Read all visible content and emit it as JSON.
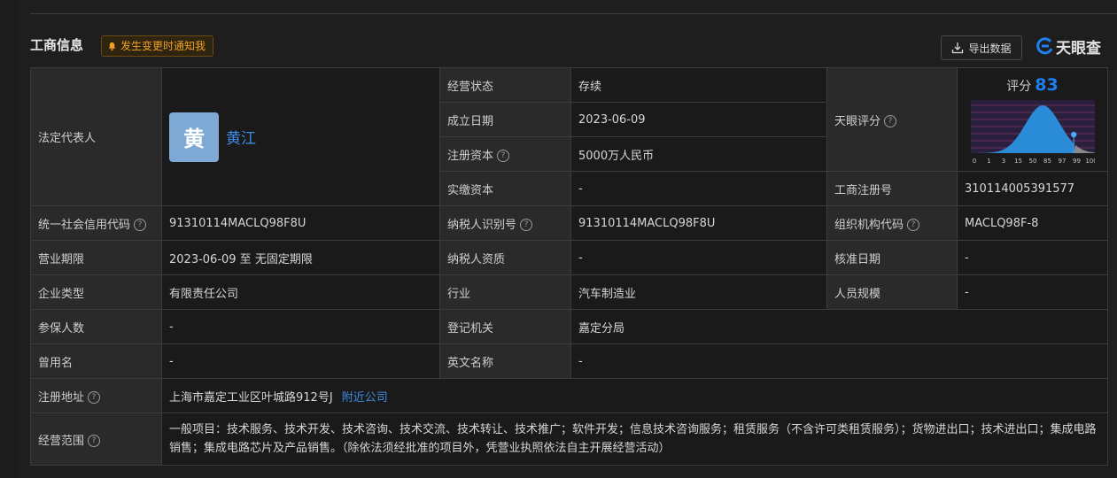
{
  "header": {
    "title": "工商信息",
    "notify_label": "发生变更时通知我",
    "export_label": "导出数据",
    "brand_name": "天眼查"
  },
  "legal_rep": {
    "label": "法定代表人",
    "avatar_char": "黄",
    "name": "黄江",
    "avatar_color": "#7da9d4"
  },
  "score": {
    "label": "天眼评分",
    "prefix": "评分",
    "value": "83",
    "value_fraction": 0.83,
    "axis_ticks": [
      "0",
      "1",
      "3",
      "15",
      "50",
      "85",
      "97",
      "99",
      "100"
    ]
  },
  "fields": {
    "business_status": {
      "label": "经营状态",
      "value": "存续"
    },
    "established": {
      "label": "成立日期",
      "value": "2023-06-09"
    },
    "registered_capital": {
      "label": "注册资本",
      "value": "5000万人民币"
    },
    "paid_capital": {
      "label": "实缴资本",
      "value": "-"
    },
    "reg_number": {
      "label": "工商注册号",
      "value": "310114005391577"
    },
    "credit_code": {
      "label": "统一社会信用代码",
      "value": "91310114MACLQ98F8U"
    },
    "taxpayer_id": {
      "label": "纳税人识别号",
      "value": "91310114MACLQ98F8U"
    },
    "org_code": {
      "label": "组织机构代码",
      "value": "MACLQ98F-8"
    },
    "term": {
      "label": "营业期限",
      "value": "2023-06-09 至 无固定期限"
    },
    "taxpayer_qual": {
      "label": "纳税人资质",
      "value": "-"
    },
    "approval_date": {
      "label": "核准日期",
      "value": "-"
    },
    "company_type": {
      "label": "企业类型",
      "value": "有限责任公司"
    },
    "industry": {
      "label": "行业",
      "value": "汽车制造业"
    },
    "staff_size": {
      "label": "人员规模",
      "value": "-"
    },
    "insured": {
      "label": "参保人数",
      "value": "-"
    },
    "authority": {
      "label": "登记机关",
      "value": "嘉定分局"
    },
    "former_name": {
      "label": "曾用名",
      "value": "-"
    },
    "english_name": {
      "label": "英文名称",
      "value": "-"
    },
    "address": {
      "label": "注册地址",
      "value": "上海市嘉定工业区叶城路912号J",
      "link": "附近公司"
    },
    "scope": {
      "label": "经营范围",
      "value": "一般项目：技术服务、技术开发、技术咨询、技术交流、技术转让、技术推广；软件开发；信息技术咨询服务；租赁服务（不含许可类租赁服务）；货物进出口；技术进出口；集成电路销售；集成电路芯片及产品销售。（除依法须经批准的项目外，凭营业执照依法自主开展经营活动）"
    }
  },
  "colors": {
    "accent": "#1e7ff0",
    "link": "#3e8de6",
    "notify": "#f0a022"
  }
}
